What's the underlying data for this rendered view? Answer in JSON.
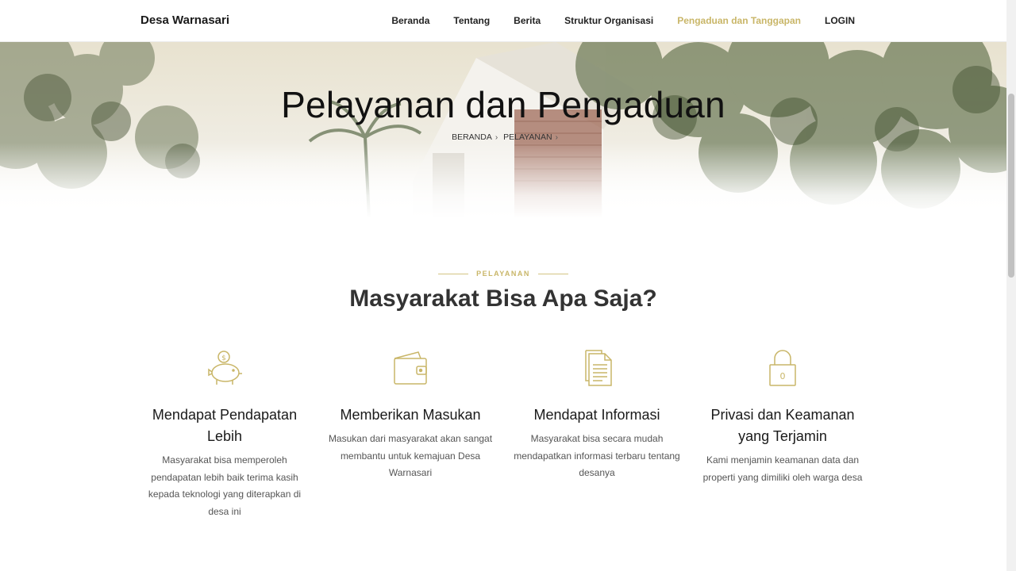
{
  "brand": "Desa Warnasari",
  "nav": {
    "items": [
      {
        "label": "Beranda"
      },
      {
        "label": "Tentang"
      },
      {
        "label": "Berita"
      },
      {
        "label": "Struktur Organisasi"
      },
      {
        "label": "Pengaduan dan Tanggapan"
      },
      {
        "label": "LOGIN"
      }
    ]
  },
  "hero": {
    "title": "Pelayanan dan Pengaduan",
    "breadcrumb": [
      "BERANDA",
      "PELAYANAN"
    ]
  },
  "section": {
    "eyebrow": "PELAYANAN",
    "title": "Masyarakat Bisa Apa Saja?"
  },
  "features": [
    {
      "icon": "piggy-bank-icon",
      "title": "Mendapat Pendapatan Lebih",
      "text": "Masyarakat bisa memperoleh pendapatan lebih baik terima kasih kepada teknologi yang diterapkan di desa ini"
    },
    {
      "icon": "wallet-icon",
      "title": "Memberikan Masukan",
      "text": "Masukan dari masyarakat akan sangat membantu untuk kemajuan Desa Warnasari"
    },
    {
      "icon": "document-icon",
      "title": "Mendapat Informasi",
      "text": "Masyarakat bisa secara mudah mendapatkan informasi terbaru tentang desanya"
    },
    {
      "icon": "lock-icon",
      "title": "Privasi dan Keamanan yang Terjamin",
      "text": "Kami menjamin keamanan data dan properti yang dimiliki oleh warga desa"
    }
  ],
  "colors": {
    "accent": "#c9b668",
    "text": "#333333"
  }
}
